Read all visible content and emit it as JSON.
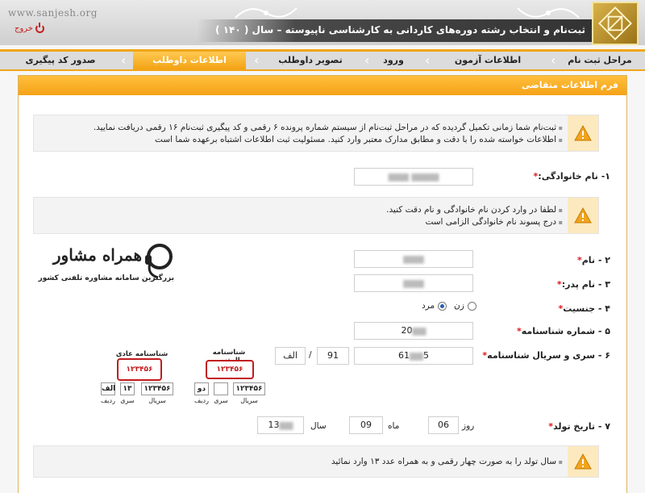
{
  "header": {
    "site_url": "www.sanjesh.org",
    "exit_label": "خروج",
    "title": "ثبت‌نام و انتخاب رشته دوره‌های کاردانی به کارشناسی ناپیوسته – سال ( ۱۴۰ )"
  },
  "nav": {
    "items": [
      {
        "label": "مراحل ثبت نام"
      },
      {
        "label": "اطلاعات آزمون"
      },
      {
        "label": "ورود"
      },
      {
        "label": "تصویر داوطلب"
      },
      {
        "label": "اطلاعات داوطلب"
      },
      {
        "label": "صدور کد پیگیری"
      }
    ],
    "active": "اطلاعات داوطلب"
  },
  "panel": {
    "title": "فرم اطلاعات متقاضی",
    "note1": [
      "ثبت‌نام شما زمانی تکمیل گردیده که در مراحل ثبت‌نام از سیستم شماره پرونده ۶ رقمی و کد پیگیری ثبت‌نام ۱۶ رقمی دریافت نمایید.",
      "اطلاعات خواسته شده را با دقت و مطابق مدارک معتبر وارد کنید. مسئولیت ثبت اطلاعات اشتباه برعهده شما است"
    ],
    "note2": [
      "لطفا در وارد کردن نام خانوادگی و نام دقت کنید.",
      "درج پسوند نام خانوادگی الزامی است"
    ],
    "note3": [
      "سال تولد را به صورت چهار رقمی و به همراه عدد ۱۳ وارد نمائید"
    ]
  },
  "form": {
    "last_name_label": "۱- نام خانوادگی:",
    "first_name_label": "۲ - نام",
    "father_name_label": "۳ - نام پدر:",
    "gender_label": "۴ - جنسیت",
    "gender_female": "زن",
    "gender_male": "مرد",
    "id_number_label": "۵ - شماره شناسنامه",
    "id_number_value": "20",
    "serial_label": "۶ - سری و سریال شناسنامه",
    "serial_value": "61",
    "serial_part2": "5",
    "serial_series_value": "91",
    "serial_letter_value": "الف",
    "birth_date_label": "۷ - تاریخ تولد",
    "day_label": "روز",
    "day_value": "06",
    "month_label": "ماه",
    "month_value": "09",
    "year_label": "سال",
    "year_value": "13"
  },
  "id_cards": {
    "smart_title": "شناسنامه المثنی",
    "smart_red_top": "دو",
    "smart_red_number": "۱۲۳۴۵۶",
    "smart_serial": "۱۲۳۴۵۶",
    "smart_series": "دو",
    "normal_title": "شناسنامه عادی",
    "normal_red_top": "الف ۱۳",
    "normal_red_number": "۱۲۳۴۵۶",
    "normal_serial": "۱۲۳۴۵۶",
    "normal_series": "۱۳",
    "normal_letter": "الف",
    "caption_serial": "سریال",
    "caption_series": "سری",
    "caption_row": "ردیف"
  },
  "watermark": {
    "title": "همراه مشاور",
    "subtitle": "بزرگترین سامانه مشاوره تلفنی کشور"
  }
}
